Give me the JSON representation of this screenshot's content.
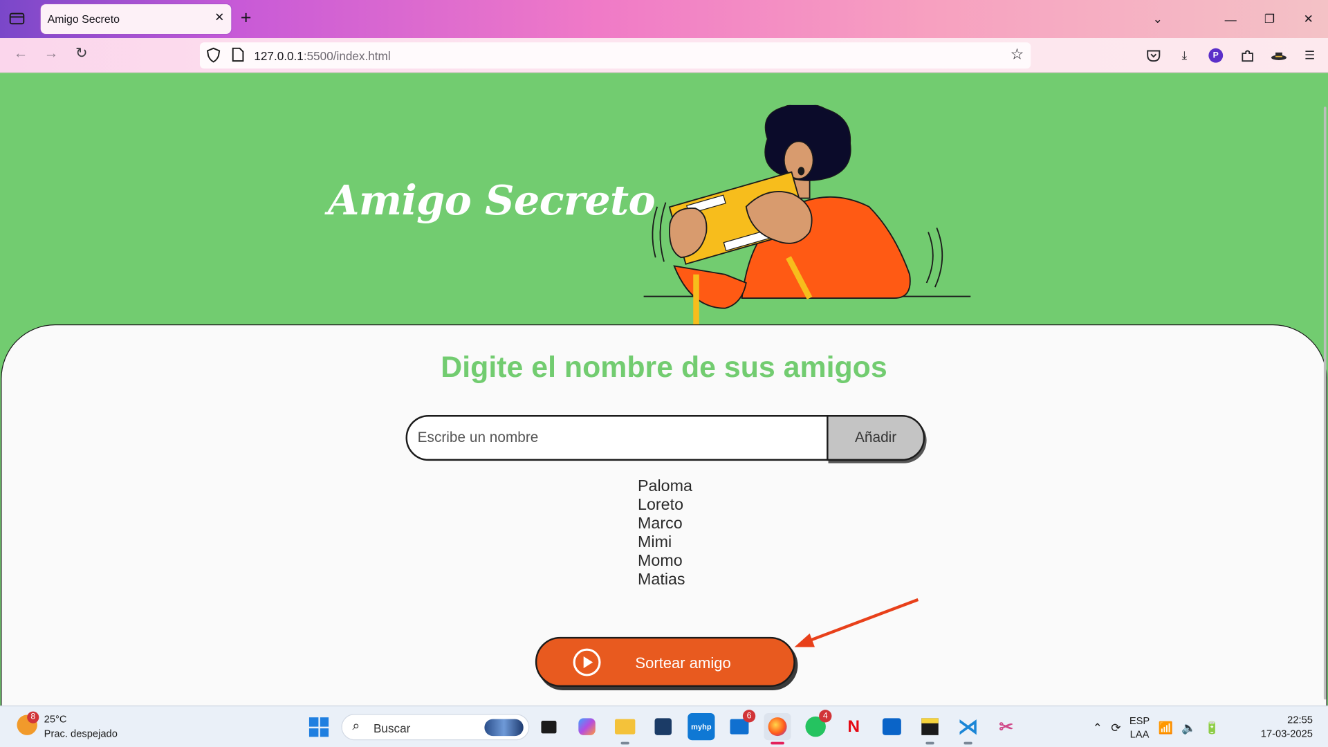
{
  "browser": {
    "tab_title": "Amigo Secreto",
    "tab_close": "✕",
    "new_tab": "+",
    "url_host": "127.0.0.1",
    "url_path": ":5500/index.html"
  },
  "page": {
    "title": "Amigo Secreto",
    "heading": "Digite el nombre de sus amigos",
    "input_placeholder": "Escribe un nombre",
    "add_button": "Añadir",
    "friends": [
      "Paloma",
      "Loreto",
      "Marco",
      "Mimi",
      "Momo",
      "Matias"
    ],
    "draw_button": "Sortear amigo",
    "accent_color": "#72cc70",
    "button_color": "#e85a1f"
  },
  "taskbar": {
    "weather_badge": "8",
    "temperature": "25°C",
    "weather_desc": "Prac. despejado",
    "search_label": "Buscar",
    "badges": {
      "mail": "6",
      "whatsapp": "4"
    },
    "lang_top": "ESP",
    "lang_bottom": "LAA",
    "time": "22:55",
    "date": "17-03-2025"
  }
}
